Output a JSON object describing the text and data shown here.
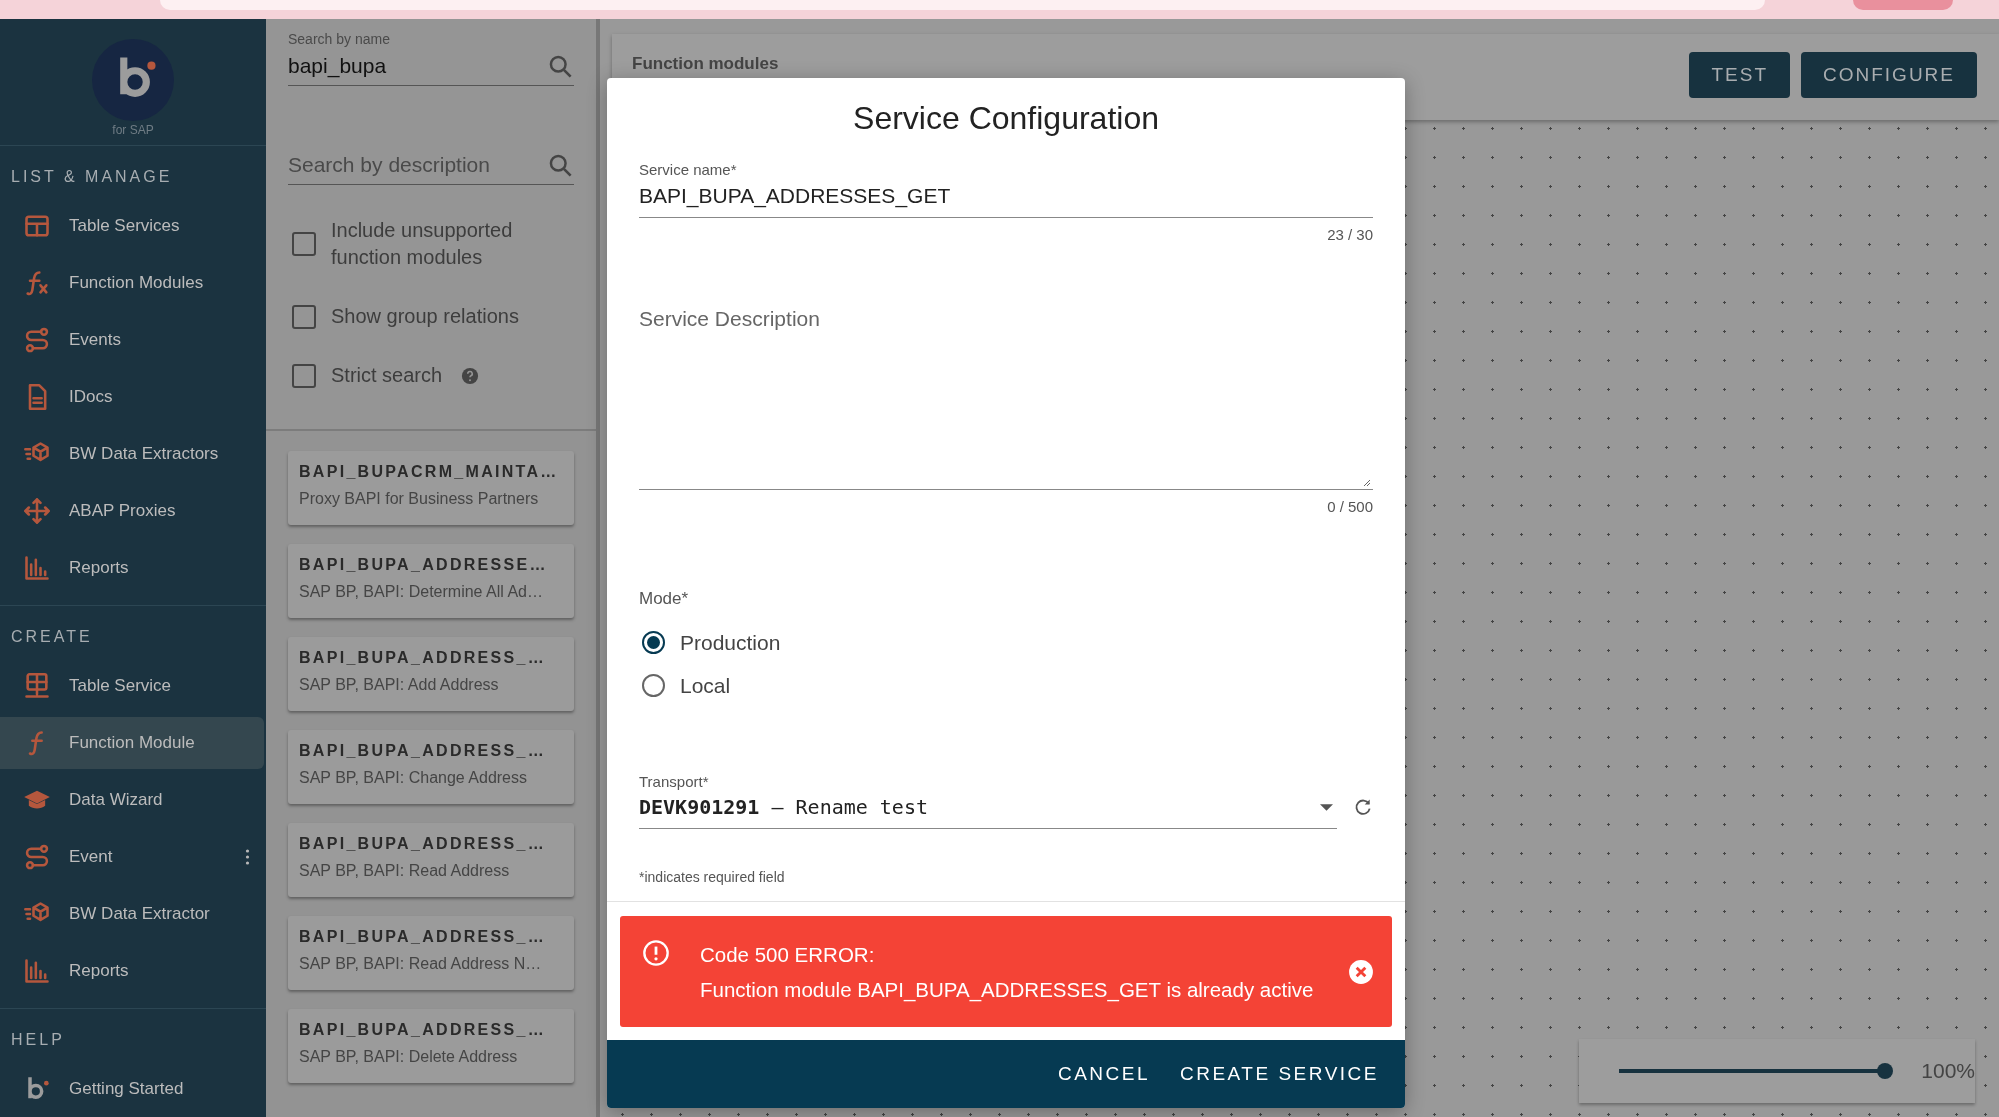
{
  "sidebar": {
    "logo_caption": "for SAP",
    "sections": [
      {
        "title": "LIST & MANAGE",
        "items": [
          {
            "label": "Table Services",
            "selected": false,
            "more_menu": false
          },
          {
            "label": "Function Modules",
            "selected": false,
            "more_menu": false
          },
          {
            "label": "Events",
            "selected": false,
            "more_menu": false
          },
          {
            "label": "IDocs",
            "selected": false,
            "more_menu": false
          },
          {
            "label": "BW Data Extractors",
            "selected": false,
            "more_menu": false
          },
          {
            "label": "ABAP Proxies",
            "selected": false,
            "more_menu": false
          },
          {
            "label": "Reports",
            "selected": false,
            "more_menu": false
          }
        ]
      },
      {
        "title": "CREATE",
        "items": [
          {
            "label": "Table Service",
            "selected": false,
            "more_menu": false
          },
          {
            "label": "Function Module",
            "selected": true,
            "more_menu": false
          },
          {
            "label": "Data Wizard",
            "selected": false,
            "more_menu": false
          },
          {
            "label": "Event",
            "selected": false,
            "more_menu": true
          },
          {
            "label": "BW Data Extractor",
            "selected": false,
            "more_menu": false
          },
          {
            "label": "Reports",
            "selected": false,
            "more_menu": false
          }
        ]
      },
      {
        "title": "HELP",
        "items": [
          {
            "label": "Getting Started",
            "selected": false,
            "more_menu": false
          }
        ]
      }
    ]
  },
  "filters": {
    "search_name": {
      "label": "Search by name",
      "value": "bapi_bupa"
    },
    "search_description": {
      "placeholder": "Search by description"
    },
    "checkboxes": [
      {
        "label": "Include unsupported function modules",
        "checked": false,
        "help": false
      },
      {
        "label": "Show group relations",
        "checked": false,
        "help": false
      },
      {
        "label": "Strict search",
        "checked": false,
        "help": true
      }
    ]
  },
  "results": [
    {
      "name": "BAPI_BUPACRM_MAINTA…",
      "description": "Proxy BAPI for Business Partners"
    },
    {
      "name": "BAPI_BUPA_ADDRESSE…",
      "description": "SAP BP, BAPI: Determine All Ad…"
    },
    {
      "name": "BAPI_BUPA_ADDRESS_…",
      "description": "SAP BP, BAPI: Add Address"
    },
    {
      "name": "BAPI_BUPA_ADDRESS_…",
      "description": "SAP BP, BAPI: Change Address"
    },
    {
      "name": "BAPI_BUPA_ADDRESS_…",
      "description": "SAP BP, BAPI: Read Address"
    },
    {
      "name": "BAPI_BUPA_ADDRESS_…",
      "description": "SAP BP, BAPI: Read Address N…"
    },
    {
      "name": "BAPI_BUPA_ADDRESS_…",
      "description": "SAP BP, BAPI: Delete Address"
    }
  ],
  "main": {
    "title": "Function modules",
    "buttons": [
      "TEST",
      "CONFIGURE"
    ],
    "zoom": {
      "level": 1,
      "reading": "100%"
    }
  },
  "dialog": {
    "title": "Service Configuration",
    "service_name": {
      "label": "Service name*",
      "value": "BAPI_BUPA_ADDRESSES_GET",
      "counter": "23 / 30"
    },
    "service_description": {
      "placeholder": "Service Description",
      "counter": "0 / 500"
    },
    "mode": {
      "label": "Mode*",
      "options": [
        {
          "label": "Production",
          "selected": true
        },
        {
          "label": "Local",
          "selected": false
        }
      ]
    },
    "transport": {
      "label": "Transport*",
      "value": "**DEVK901291** – Rename test"
    },
    "required_note": "*indicates required field",
    "error": {
      "title": "Code 500 ERROR:",
      "message": "Function module BAPI_BUPA_ADDRESSES_GET is already active"
    },
    "actions": [
      "CANCEL",
      "CREATE SERVICE"
    ]
  }
}
